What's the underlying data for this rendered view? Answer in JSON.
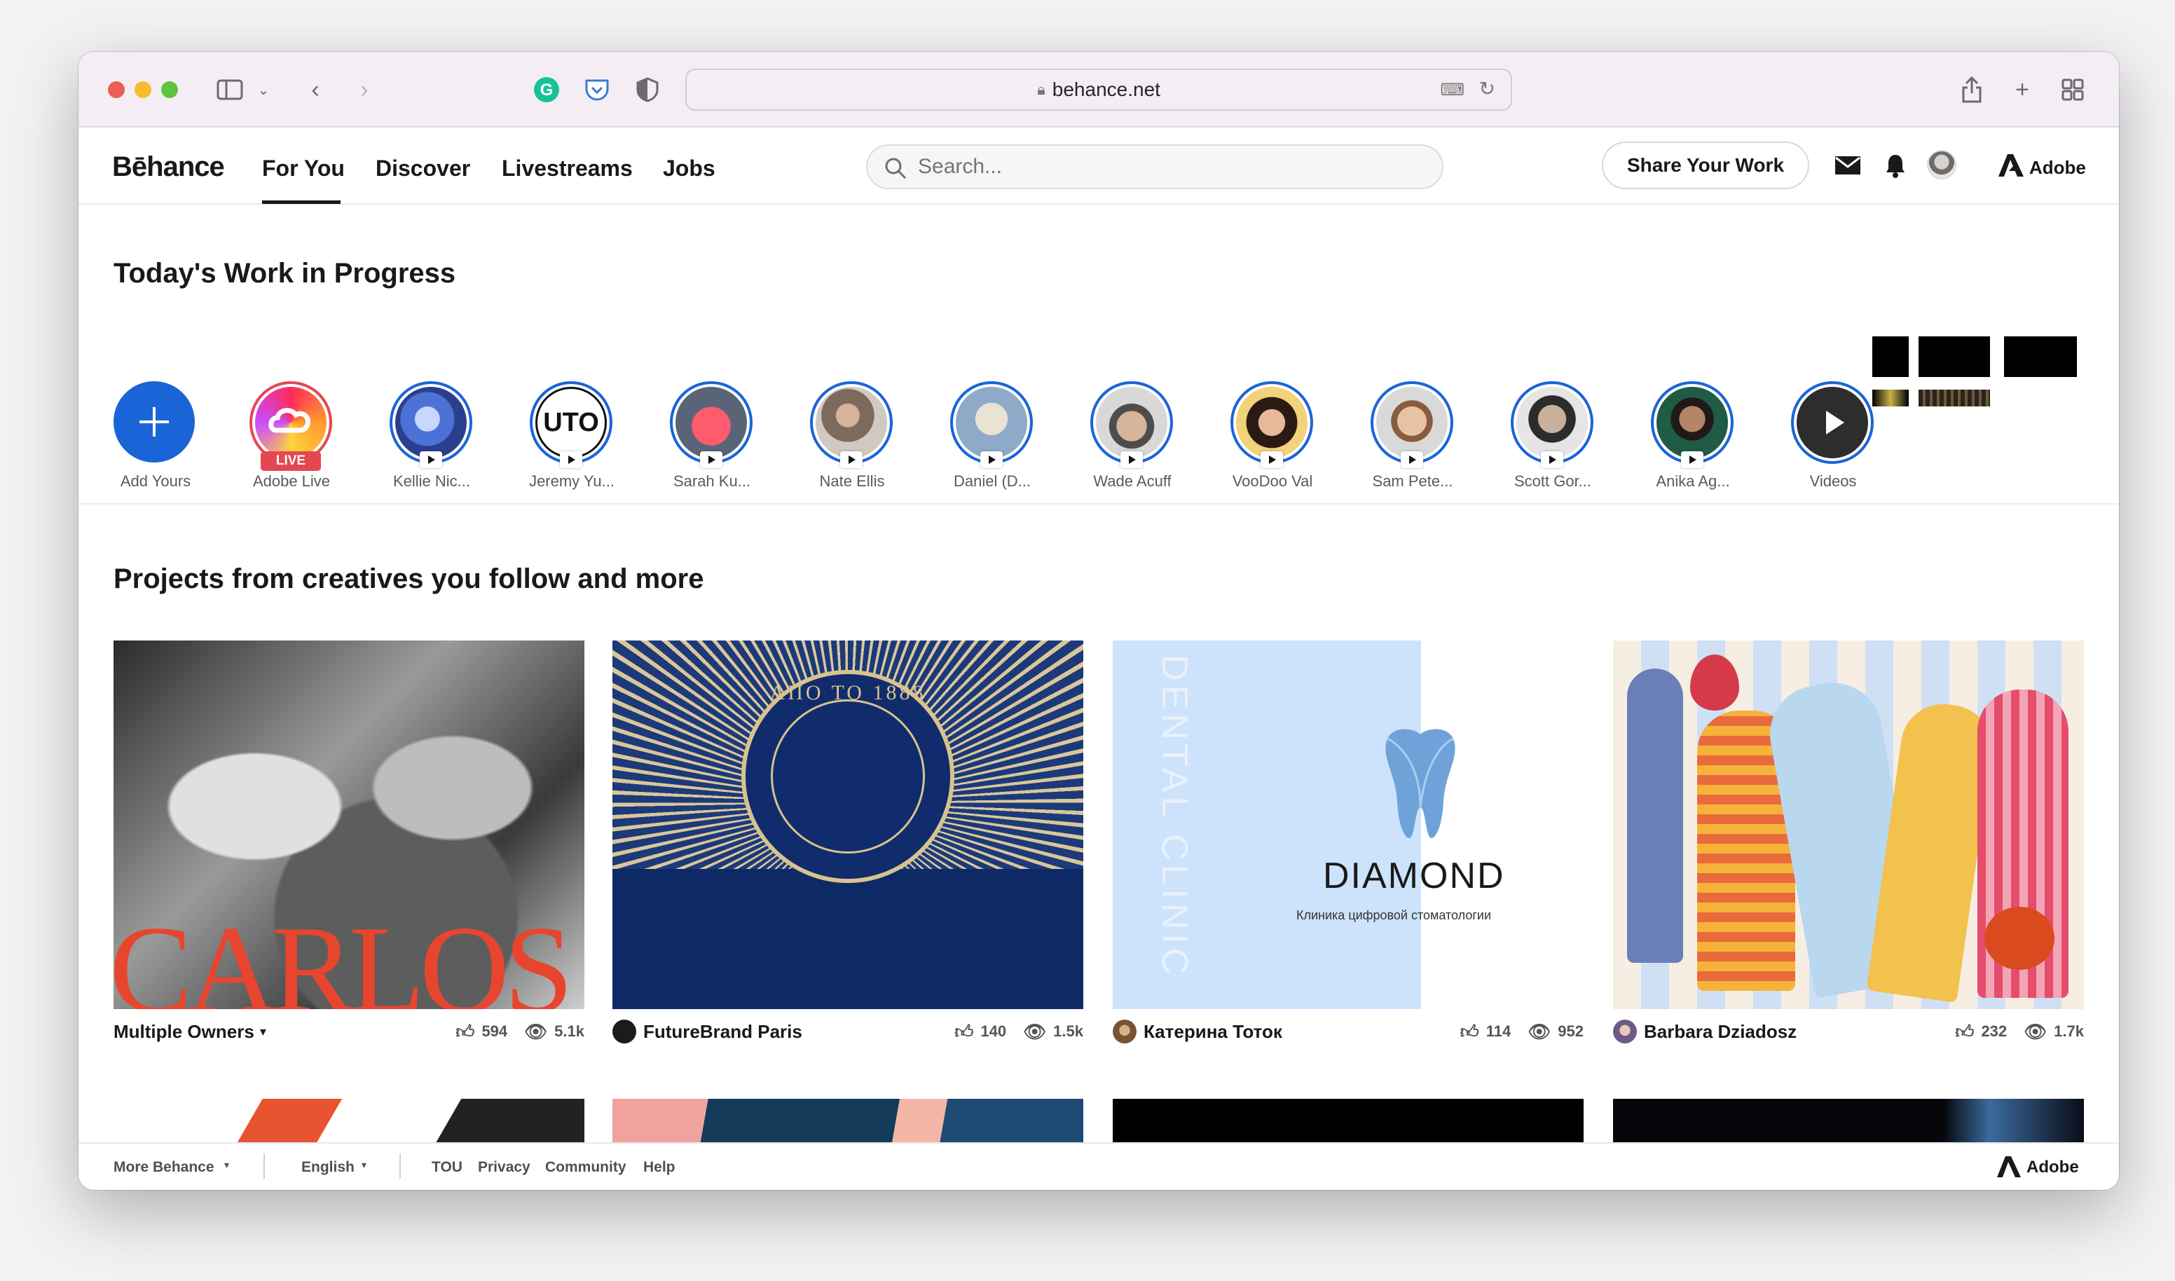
{
  "browser": {
    "url": "behance.net"
  },
  "nav": {
    "logo": "Bēhance",
    "links": [
      "For You",
      "Discover",
      "Livestreams",
      "Jobs"
    ],
    "search_placeholder": "Search...",
    "share_button": "Share Your Work",
    "adobe_label": "Adobe"
  },
  "wip": {
    "title": "Today's Work in Progress",
    "add_label": "Add Yours",
    "live_badge": "LIVE",
    "stories": [
      {
        "label": "Adobe Live"
      },
      {
        "label": "Kellie Nic..."
      },
      {
        "label": "Jeremy Yu..."
      },
      {
        "label": "Sarah Ku..."
      },
      {
        "label": "Nate Ellis"
      },
      {
        "label": "Daniel (D..."
      },
      {
        "label": "Wade Acuff"
      },
      {
        "label": "VooDoo Val"
      },
      {
        "label": "Sam Pete..."
      },
      {
        "label": "Scott Gor..."
      },
      {
        "label": "Anika Ag..."
      },
      {
        "label": "Videos"
      }
    ]
  },
  "projects": {
    "title": "Projects from creatives you follow and more",
    "items": [
      {
        "owner": "Multiple Owners",
        "likes": "594",
        "views": "5.1k",
        "art_text": "CARLOS"
      },
      {
        "owner": "FutureBrand Paris",
        "likes": "140",
        "views": "1.5k",
        "art_text": "ΑΠΟ ΤΟ 1888"
      },
      {
        "owner": "Катерина Тоток",
        "likes": "114",
        "views": "952",
        "art_text": "DIAMOND",
        "art_sub": "Клиника цифровой стоматологии",
        "art_side": "DENTAL CLINIC"
      },
      {
        "owner": "Barbara Dziadosz",
        "likes": "232",
        "views": "1.7k"
      }
    ]
  },
  "footer": {
    "more": "More Behance",
    "language": "English",
    "links": [
      "TOU",
      "Privacy",
      "Community",
      "Help"
    ],
    "adobe_label": "Adobe"
  },
  "colors": {
    "accent_blue": "#1a64d8",
    "live_red": "#e34850"
  }
}
